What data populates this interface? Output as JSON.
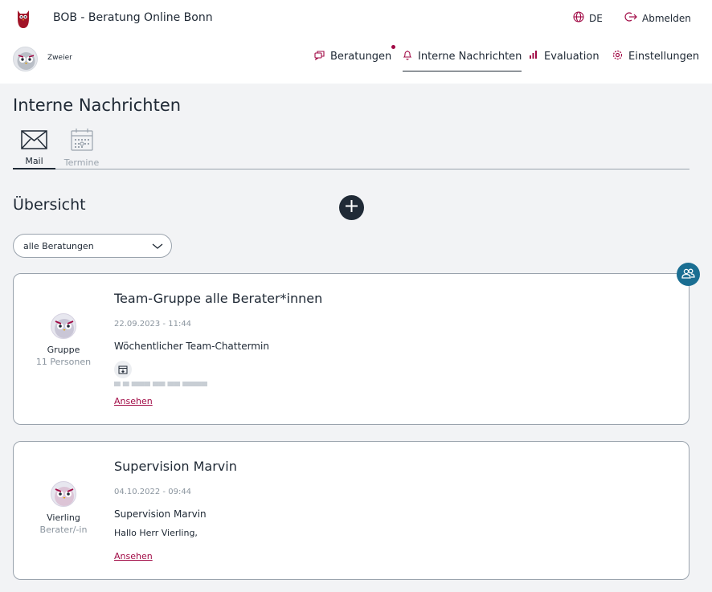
{
  "header": {
    "app_title": "BOB - Beratung Online Bonn",
    "language": "DE",
    "logout_label": "Abmelden",
    "user_name": "Zweier"
  },
  "nav": {
    "items": [
      {
        "label": "Beratungen",
        "icon": "chat-bubbles-icon",
        "notification": true
      },
      {
        "label": "Interne Nachrichten",
        "icon": "bell-icon",
        "active": true
      },
      {
        "label": "Evaluation",
        "icon": "bar-chart-icon"
      },
      {
        "label": "Einstellungen",
        "icon": "gear-icon"
      }
    ]
  },
  "page": {
    "title": "Interne Nachrichten",
    "subtabs": [
      {
        "label": "Mail",
        "active": true
      },
      {
        "label": "Termine",
        "active": false
      }
    ],
    "overview_title": "Übersicht",
    "filter_value": "alle Beratungen"
  },
  "cards": [
    {
      "title": "Team-Gruppe alle Berater*innen",
      "date": "22.09.2023 - 11:44",
      "subject": "Wöchentlicher Team-Chattermin",
      "side_name": "Gruppe",
      "side_sub": "11 Personen",
      "link": "Ansehen"
    },
    {
      "title": "Supervision Marvin",
      "date": "04.10.2022 - 09:44",
      "subject": "Supervision Marvin",
      "body": "Hallo Herr Vierling,",
      "side_name": "Vierling",
      "side_sub": "Berater/-in",
      "link": "Ansehen"
    }
  ],
  "colors": {
    "accent": "#a10a45",
    "dark": "#202a36",
    "badge": "#1a6e92",
    "muted": "#8a949e"
  }
}
